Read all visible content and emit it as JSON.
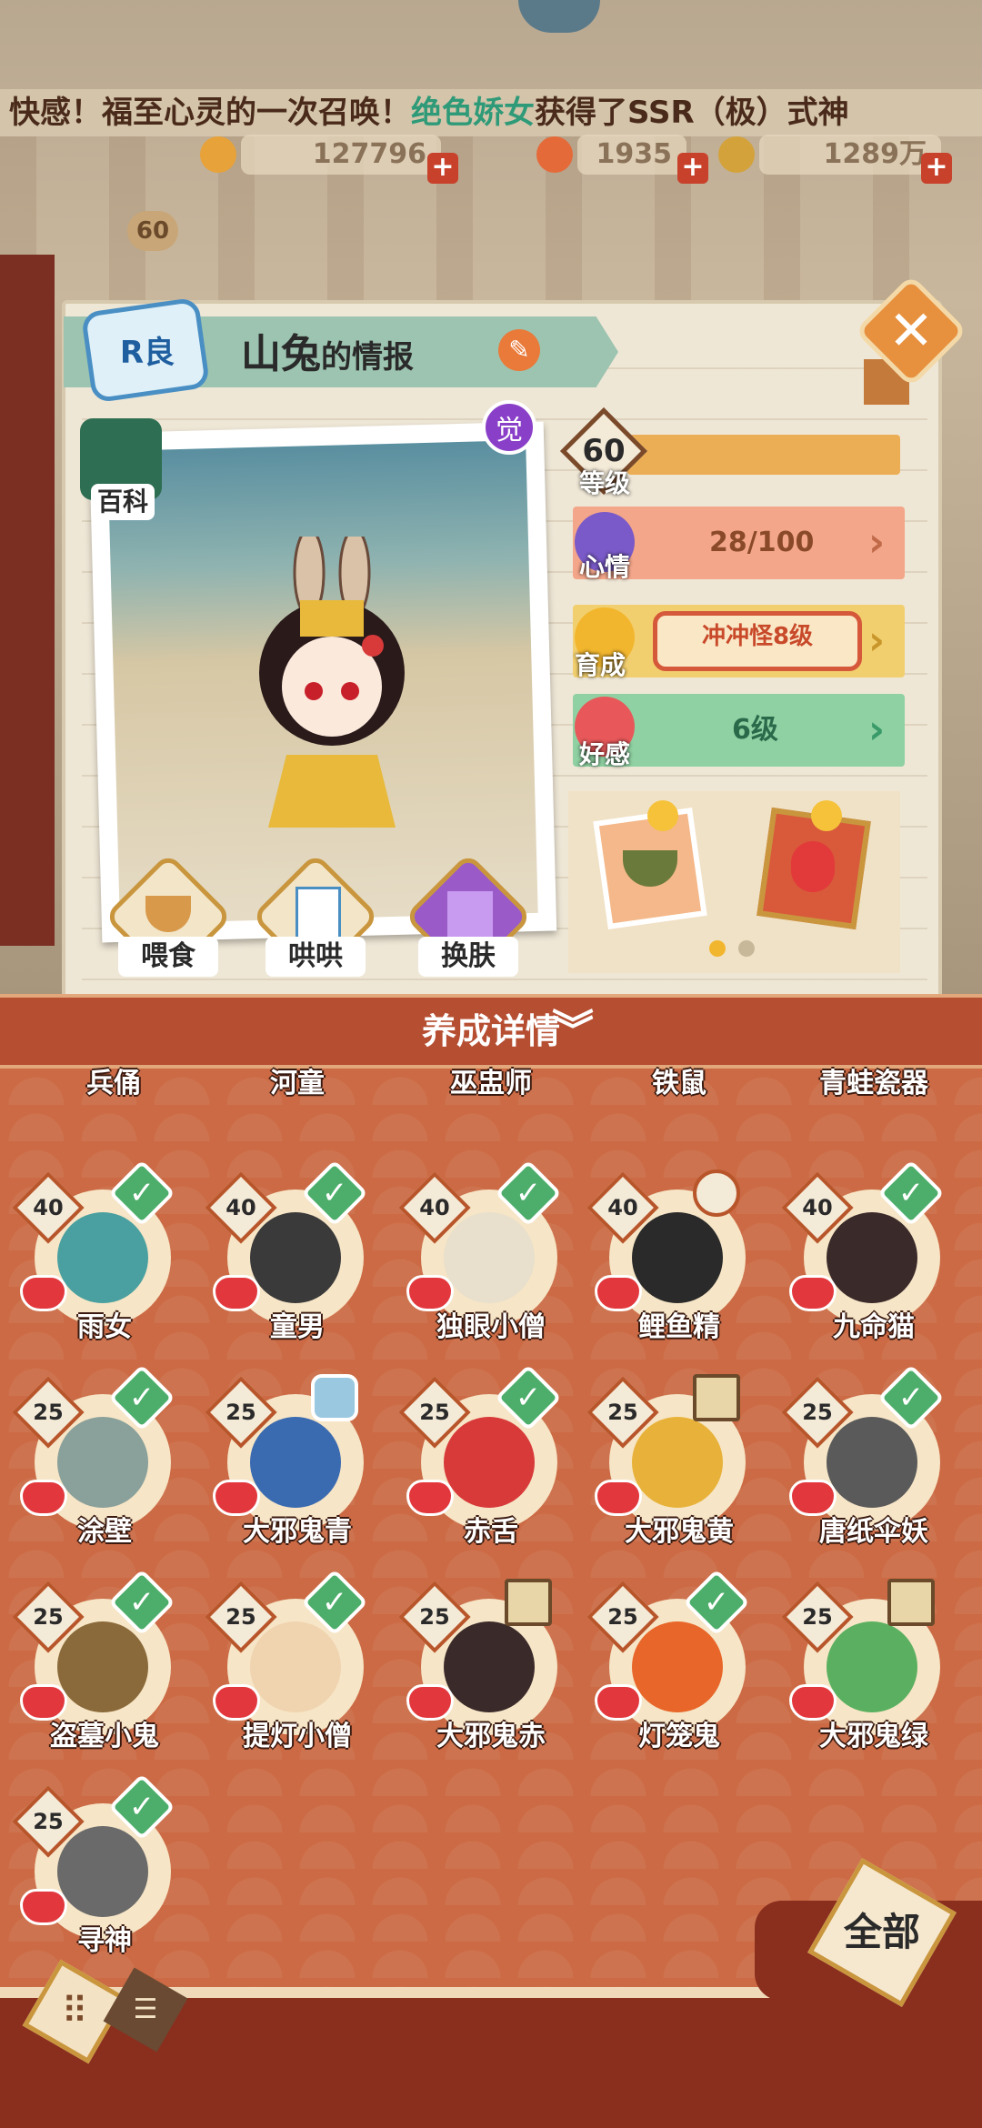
{
  "ticker": {
    "prefix": "快感！福至心灵的一次召唤！",
    "highlight": "绝色娇女",
    "suffix": "获得了SSR（极）式神"
  },
  "resources": {
    "coins": "127796",
    "jade": "1935",
    "gold": "1289万"
  },
  "player_level": "60",
  "panel": {
    "rarity": "R良",
    "name": "山兔",
    "title_suffix": "的情报",
    "wiki_label": "百科",
    "awaken_label": "觉"
  },
  "stats": {
    "level_value": "60",
    "level_label": "等级",
    "mood_label": "心情",
    "mood_value": "28/100",
    "growth_label": "育成",
    "growth_value": "冲冲怪8级",
    "affection_label": "好感",
    "affection_value": "6级"
  },
  "actions": {
    "feed": "喂食",
    "coax": "哄哄",
    "skin": "换肤"
  },
  "details": {
    "label": "养成详情"
  },
  "shikigami_top_row": [
    "兵俑",
    "河童",
    "巫盅师",
    "铁鼠",
    "青蛙瓷器"
  ],
  "shikigami": [
    {
      "name": "雨女",
      "level": "40",
      "badge": "check"
    },
    {
      "name": "童男",
      "level": "40",
      "badge": "check"
    },
    {
      "name": "独眼小僧",
      "level": "40",
      "badge": "check"
    },
    {
      "name": "鲤鱼精",
      "level": "40",
      "badge": "ring"
    },
    {
      "name": "九命猫",
      "level": "40",
      "badge": "check"
    },
    {
      "name": "涂壁",
      "level": "25",
      "badge": "check"
    },
    {
      "name": "大邪鬼青",
      "level": "25",
      "badge": "figure"
    },
    {
      "name": "赤舌",
      "level": "25",
      "badge": "check"
    },
    {
      "name": "大邪鬼黄",
      "level": "25",
      "badge": "flag"
    },
    {
      "name": "唐纸伞妖",
      "level": "25",
      "badge": "check"
    },
    {
      "name": "盗墓小鬼",
      "level": "25",
      "badge": "check"
    },
    {
      "name": "提灯小僧",
      "level": "25",
      "badge": "check"
    },
    {
      "name": "大邪鬼赤",
      "level": "25",
      "badge": "flag"
    },
    {
      "name": "灯笼鬼",
      "level": "25",
      "badge": "check"
    },
    {
      "name": "大邪鬼绿",
      "level": "25",
      "badge": "flag"
    },
    {
      "name": "寻神",
      "level": "25",
      "badge": "check"
    }
  ],
  "bottom": {
    "all_label": "全部",
    "grid_view_icon": "grid-icon",
    "list_view_icon": "list-icon"
  },
  "colors": {
    "panel_bg": "#efe7d6",
    "grid_bg": "#cb6a44",
    "details_bar": "#b64e32",
    "check_green": "#4cae6a",
    "heart_red": "#e2383d"
  }
}
